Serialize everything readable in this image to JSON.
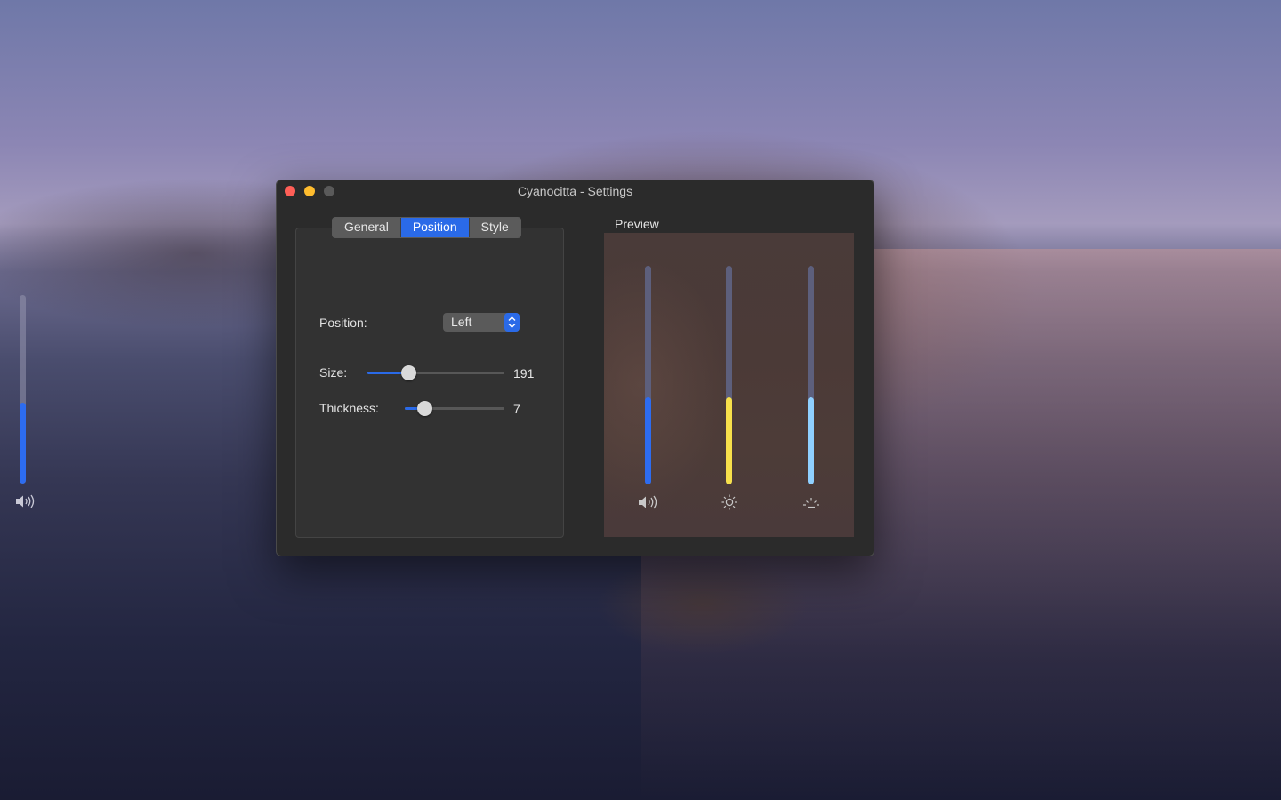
{
  "window": {
    "title": "Cyanocitta - Settings"
  },
  "tabs": [
    {
      "label": "General",
      "active": false
    },
    {
      "label": "Position",
      "active": true
    },
    {
      "label": "Style",
      "active": false
    }
  ],
  "position": {
    "label": "Position:",
    "value": "Left"
  },
  "size": {
    "label": "Size:",
    "value": "191",
    "fraction": 0.3
  },
  "thickness": {
    "label": "Thickness:",
    "value": "7",
    "fraction": 0.2
  },
  "preview": {
    "label": "Preview",
    "bars": [
      {
        "icon": "volume-icon",
        "level": 0.4,
        "color": "#2d6cf0"
      },
      {
        "icon": "brightness-icon",
        "level": 0.4,
        "color": "#f7e04b"
      },
      {
        "icon": "keyboard-brightness-icon",
        "level": 0.4,
        "color": "#8fd0ff"
      }
    ]
  },
  "desktop_hud": {
    "icon": "volume-icon",
    "level": 0.43,
    "color": "#2d6cf0"
  },
  "colors": {
    "accent": "#2a6ae8",
    "window_bg": "#2b2b2b"
  }
}
